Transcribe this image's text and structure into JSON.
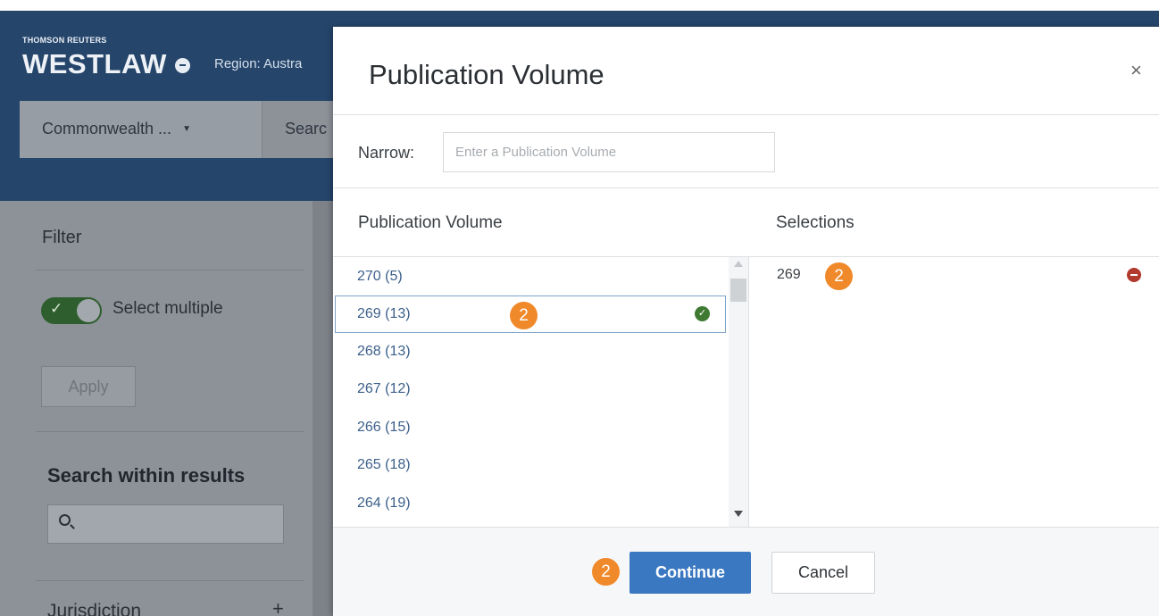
{
  "app": {
    "brand_small": "THOMSON REUTERS",
    "brand_name": "WESTLAW",
    "region": "Region: Austra",
    "jurisdiction_select": "Commonwealth ...",
    "search_label": "Searc"
  },
  "sidebar": {
    "filter_title": "Filter",
    "select_multiple": "Select multiple",
    "apply_label": "Apply",
    "search_within_title": "Search within results",
    "jurisdiction_label": "Jurisdiction",
    "jurisdiction_expand": "+"
  },
  "modal": {
    "title": "Publication Volume",
    "close": "×",
    "narrow_label": "Narrow:",
    "narrow_placeholder": "Enter a Publication Volume",
    "list_header": "Publication Volume",
    "selections_header": "Selections",
    "items": [
      {
        "label": "270 (5)"
      },
      {
        "label": "269 (13)",
        "selected": true
      },
      {
        "label": "268 (13)"
      },
      {
        "label": "267 (12)"
      },
      {
        "label": "266 (15)"
      },
      {
        "label": "265 (18)"
      },
      {
        "label": "264 (19)"
      }
    ],
    "selections": [
      {
        "label": "269"
      }
    ],
    "continue_label": "Continue",
    "cancel_label": "Cancel"
  },
  "annotations": {
    "step_badge": "2"
  },
  "colors": {
    "header_bg": "#25456b",
    "primary_button": "#3a78c2",
    "badge": "#f0892a",
    "check": "#3f7a33",
    "remove": "#b23a2e",
    "link": "#3b5f8a"
  }
}
